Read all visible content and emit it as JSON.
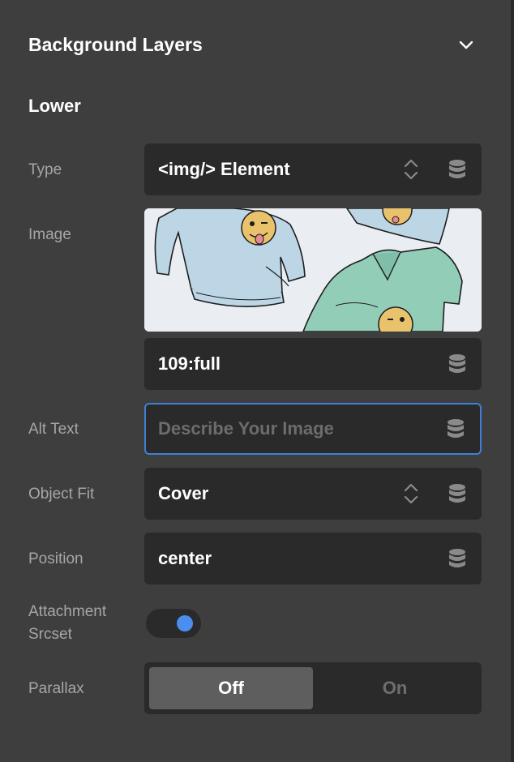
{
  "header": {
    "title": "Background Layers"
  },
  "section": {
    "title": "Lower"
  },
  "fields": {
    "type": {
      "label": "Type",
      "value": "<img/> Element"
    },
    "image": {
      "label": "Image",
      "size_value": "109:full"
    },
    "alt_text": {
      "label": "Alt Text",
      "placeholder": "Describe Your Image",
      "value": ""
    },
    "object_fit": {
      "label": "Object Fit",
      "value": "Cover"
    },
    "position": {
      "label": "Position",
      "value": "center"
    },
    "attachment_srcset": {
      "label_line1": "Attachment",
      "label_line2": "Srcset",
      "enabled": true
    },
    "parallax": {
      "label": "Parallax",
      "options": [
        "Off",
        "On"
      ],
      "selected": "Off"
    }
  },
  "icons": {
    "collapse": "chevron-down-icon",
    "stepper": "up-down-chevrons-icon",
    "dynamic_data": "database-icon"
  },
  "colors": {
    "panel_bg": "#3e3e3e",
    "field_bg": "#2a2a2a",
    "focus_border": "#3f7fd9",
    "toggle_on": "#4a8ef0",
    "label_text": "#a6a6a6",
    "segment_active": "#5e5e5e"
  }
}
